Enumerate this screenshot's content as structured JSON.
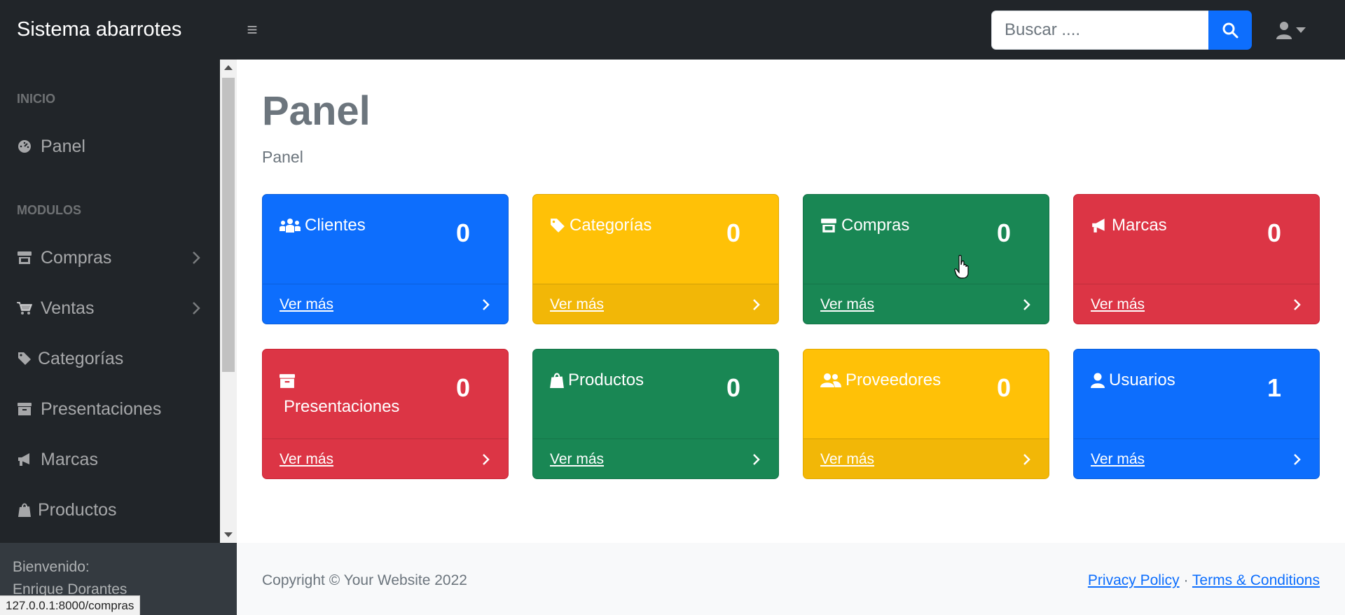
{
  "app": {
    "brand": "Sistema abarrotes"
  },
  "search": {
    "placeholder": "Buscar ...."
  },
  "sidebar": {
    "sections": [
      {
        "heading": "INICIO"
      },
      {
        "heading": "MODULOS"
      }
    ],
    "items": [
      {
        "label": "Panel",
        "icon": "gauge-icon"
      },
      {
        "label": "Compras",
        "icon": "store-icon"
      },
      {
        "label": "Ventas",
        "icon": "cart-icon"
      },
      {
        "label": "Categorías",
        "icon": "tag-icon"
      },
      {
        "label": "Presentaciones",
        "icon": "archive-icon"
      },
      {
        "label": "Marcas",
        "icon": "bullhorn-icon"
      },
      {
        "label": "Productos",
        "icon": "shopify-icon"
      }
    ],
    "footer": {
      "welcome": "Bienvenido:",
      "user": "Enrique Dorantes"
    }
  },
  "main": {
    "title": "Panel",
    "breadcrumb": "Panel",
    "cards": [
      {
        "title": "Clientes",
        "count": "0",
        "more": "Ver más",
        "color": "#0d6efd",
        "icon": "users-icon"
      },
      {
        "title": "Categorías",
        "count": "0",
        "more": "Ver más",
        "color": "#ffc107",
        "icon": "tag-icon"
      },
      {
        "title": "Compras",
        "count": "0",
        "more": "Ver más",
        "color": "#198754",
        "icon": "store-icon"
      },
      {
        "title": "Marcas",
        "count": "0",
        "more": "Ver más",
        "color": "#dc3545",
        "icon": "bullhorn-icon"
      },
      {
        "title": "Presentaciones",
        "count": "0",
        "more": "Ver más",
        "color": "#dc3545",
        "icon": "archive-icon"
      },
      {
        "title": "Productos",
        "count": "0",
        "more": "Ver más",
        "color": "#198754",
        "icon": "shopify-icon"
      },
      {
        "title": "Proveedores",
        "count": "0",
        "more": "Ver más",
        "color": "#ffc107",
        "icon": "user-group-icon"
      },
      {
        "title": "Usuarios",
        "count": "1",
        "more": "Ver más",
        "color": "#0d6efd",
        "icon": "user-icon"
      }
    ]
  },
  "footer": {
    "copyright": "Copyright © Your Website 2022",
    "links": {
      "privacy": "Privacy Policy",
      "separator": "·",
      "terms": "Terms & Conditions"
    }
  },
  "status_bar": {
    "url": "127.0.0.1:8000/compras"
  }
}
